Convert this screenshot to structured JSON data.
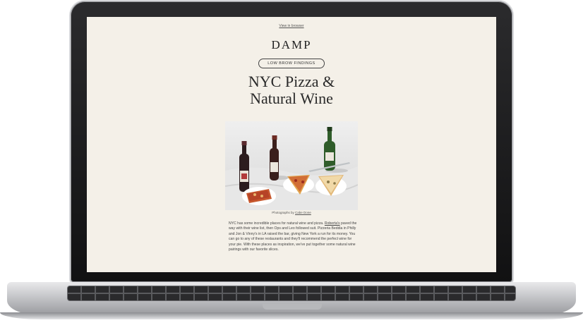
{
  "email": {
    "view_in_browser": "View in browser",
    "brand_logo": "DAMP",
    "tag": "LOW BROW FINDINGS",
    "headline_line1": "NYC Pizza &",
    "headline_line2": "Natural Wine",
    "photo_caption_prefix": "Photographs by",
    "photo_caption_link": "Cabe Done",
    "body_part1": "NYC has some incredible places for natural wine and pizza.",
    "body_link": "Roberta's",
    "body_part2": "paved the way with their wine list, then Ops and Leo followed suit. Pizzeria Beddia in Philly and Jon & Vinny's in LA raised the bar, giving New York a run for its money. You can go to any of these restaurants and they'll recommend the perfect wine for your pie. With these places as inspiration, we've put together some natural wine pairings with our favorite slices."
  },
  "colors": {
    "screen_background": "#f4f0e8",
    "text": "#2a2a2a"
  }
}
